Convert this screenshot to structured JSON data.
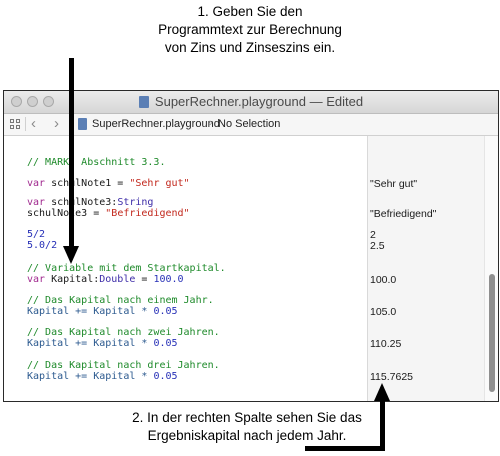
{
  "annotations": {
    "top_lines": [
      "1. Geben Sie den",
      "Programmtext zur Berechnung",
      "von Zins und Zinseszins ein."
    ],
    "bottom_lines": [
      "2. In der rechten Spalte sehen Sie das",
      "Ergebniskapital nach jedem Jahr."
    ]
  },
  "window": {
    "title": "SuperRechner.playground — Edited",
    "jumpbar": {
      "file": "SuperRechner.playground",
      "selection": "No Selection"
    }
  },
  "code": {
    "l1": {
      "comment": "// MARK: Abschnitt 3.3."
    },
    "l2": {
      "kw": "var",
      "name": " schulNote1 = ",
      "str": "\"Sehr gut\""
    },
    "l3": {
      "kw": "var",
      "name": " schulNote3:",
      "type": "String"
    },
    "l4": {
      "name": "schulNote3 = ",
      "str": "\"Befriedigend\""
    },
    "l5": {
      "text": "5/2"
    },
    "l6": {
      "text": "5.0/2"
    },
    "l7": {
      "comment": "// Variable mit dem Startkapital."
    },
    "l8": {
      "kw": "var",
      "name": " Kapital:",
      "type": "Double",
      "op": " = ",
      "num": "100.0"
    },
    "l9": {
      "comment": "// Das Kapital nach einem Jahr."
    },
    "l10": {
      "name": "Kapital += Kapital * ",
      "num": "0.05"
    },
    "l11": {
      "comment": "// Das Kapital nach zwei Jahren."
    },
    "l12": {
      "name": "Kapital += Kapital * ",
      "num": "0.05"
    },
    "l13": {
      "comment": "// Das Kapital nach drei Jahren."
    },
    "l14": {
      "name": "Kapital += Kapital * ",
      "num": "0.05"
    }
  },
  "results": {
    "r1": "\"Sehr gut\"",
    "r2": "\"Befriedigend\"",
    "r3": "2",
    "r4": "2.5",
    "r5": "100.0",
    "r6": "105.0",
    "r7": "110.25",
    "r8": "115.7625"
  },
  "colors": {
    "comment": "#1e8a2a",
    "keyword": "#a12a8f",
    "string": "#c2271c",
    "number": "#2730b7"
  }
}
